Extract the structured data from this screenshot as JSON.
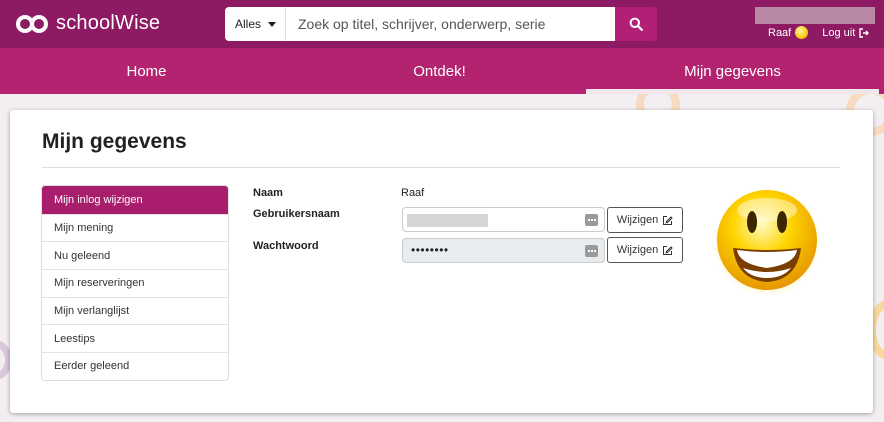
{
  "header": {
    "logo_text": "schoolWise",
    "search": {
      "scope": "Alles",
      "placeholder": "Zoek op titel, schrijver, onderwerp, serie"
    },
    "user_name": "Raaf",
    "logout_label": "Log uit"
  },
  "nav": {
    "items": [
      {
        "label": "Home"
      },
      {
        "label": "Ontdek!"
      },
      {
        "label": "Mijn gegevens"
      }
    ],
    "active_index": 2
  },
  "page": {
    "title": "Mijn gegevens",
    "sidebar": [
      {
        "label": "Mijn inlog wijzigen"
      },
      {
        "label": "Mijn mening"
      },
      {
        "label": "Nu geleend"
      },
      {
        "label": "Mijn reserveringen"
      },
      {
        "label": "Mijn verlanglijst"
      },
      {
        "label": "Leestips"
      },
      {
        "label": "Eerder geleend"
      }
    ],
    "sidebar_active_index": 0,
    "form": {
      "name_label": "Naam",
      "name_value": "Raaf",
      "username_label": "Gebruikersnaam",
      "password_label": "Wachtwoord",
      "password_value": "••••••••",
      "edit_label": "Wijzigen"
    }
  },
  "colors": {
    "header_bg": "#8e1a64",
    "nav_bg": "#b3236f",
    "accent": "#a91e6c"
  },
  "icons": {
    "search": "search-icon",
    "user_avatar": "smiley-icon",
    "logout": "logout-icon",
    "edit": "edit-icon",
    "field_keyboard": "keyboard-icon"
  }
}
